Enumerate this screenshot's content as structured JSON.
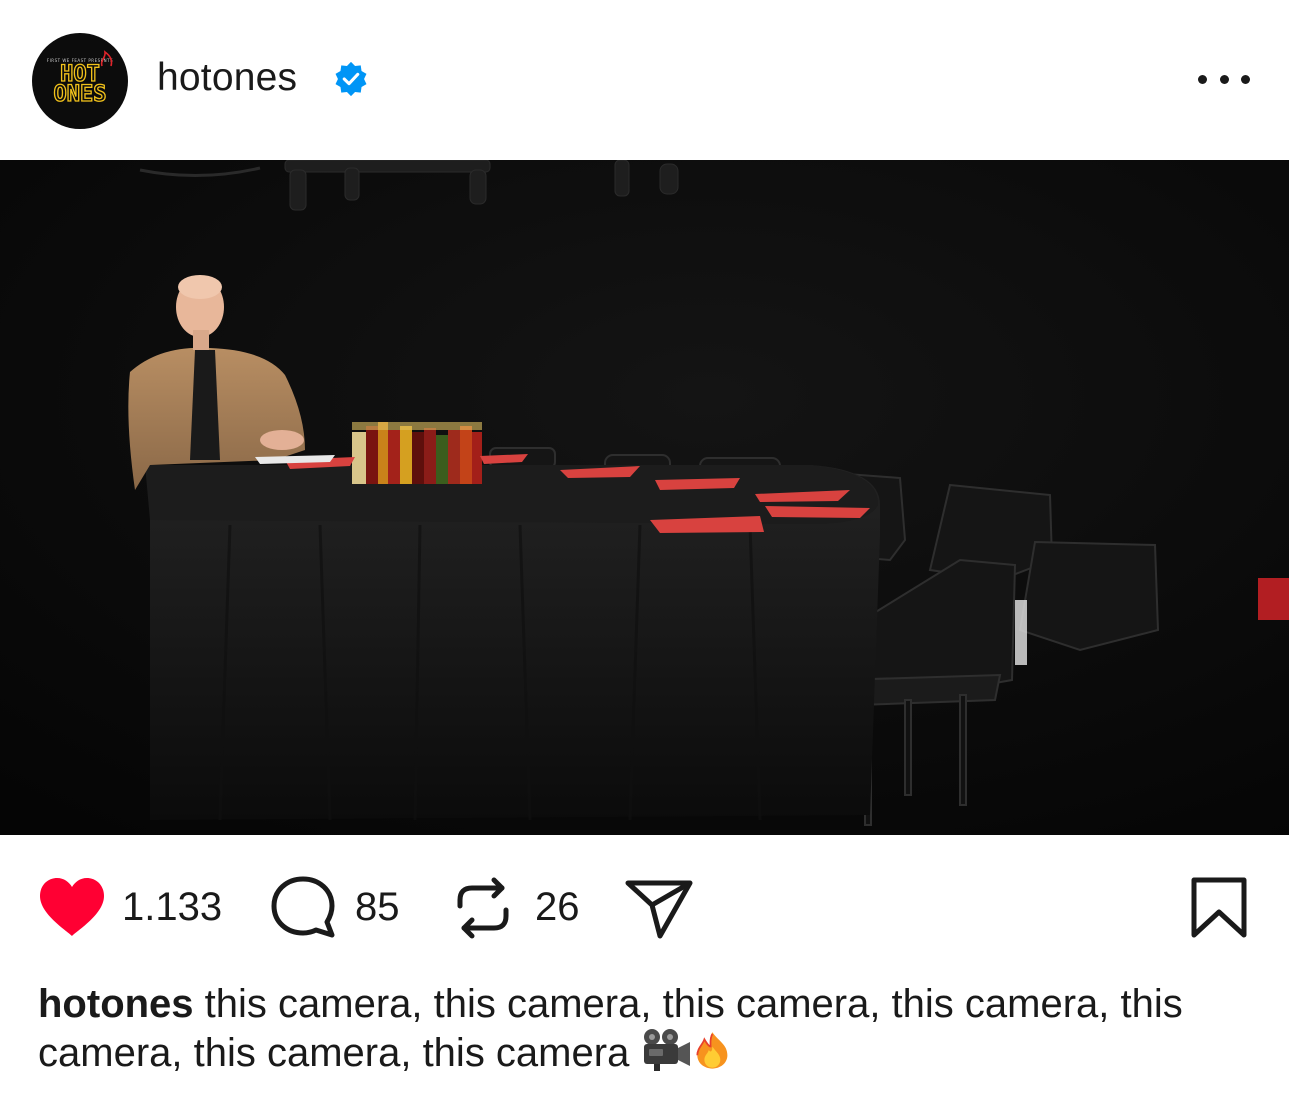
{
  "post": {
    "username": "hotones",
    "verified": true,
    "avatar": {
      "small_text": "FIRST WE FEAST PRESENTS",
      "logo_line1": "HOT",
      "logo_line2": "ONES"
    },
    "more_icon": "more-horizontal-icon",
    "image_alt": "Host seated at a long black-draped table with a row of hot sauce bottles and red napkins, empty black chairs, studio lights overhead"
  },
  "actions": {
    "likes": "1.133",
    "comments": "85",
    "reposts": "26",
    "icons": [
      "heart-icon",
      "comment-icon",
      "repost-icon",
      "share-icon",
      "bookmark-icon"
    ],
    "liked": true
  },
  "caption": {
    "username": "hotones",
    "text": " this camera, this camera, this camera, this camera, this camera, this camera, this camera ",
    "emojis": [
      "movie-camera-emoji",
      "fire-emoji"
    ]
  },
  "colors": {
    "like_red": "#ff0033",
    "verified_blue": "#0095f6",
    "logo_yellow": "#f2c21b",
    "napkin_red": "#d8423f"
  }
}
